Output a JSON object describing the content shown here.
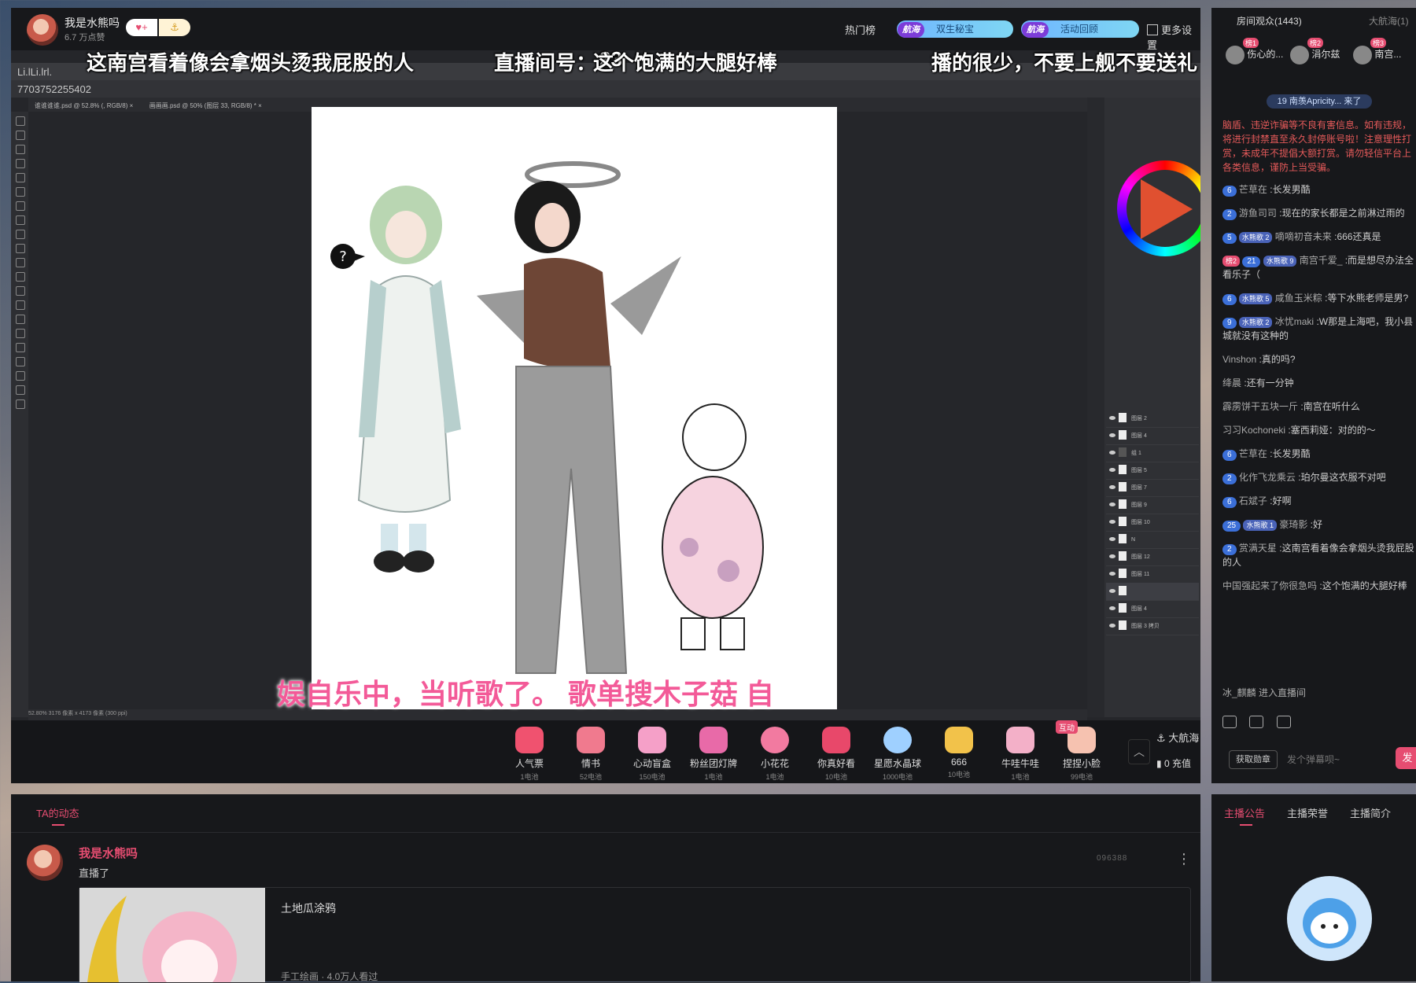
{
  "header": {
    "streamer_name": "我是水熊吗",
    "likes": "6.7 万点赞",
    "hot_rank": "热门榜",
    "pills": [
      {
        "badge": "航海",
        "label": "双生秘宝"
      },
      {
        "badge": "航海",
        "label": "活动回顾"
      }
    ],
    "more_settings": "更多设置"
  },
  "video": {
    "watermark": "Li.lLi.lrl.",
    "room_id": "7703752255402",
    "danmu": [
      "这南宫看着像会拿烟头烫我屁股的人",
      "直播间号：",
      "23",
      "这个饱满的大腿好棒",
      "播的很少，不要上舰不要送礼"
    ],
    "scroll_banner": "娱自乐中，当听歌了。   歌单搜木子菇   自",
    "ps": {
      "tabs": [
        "谁谁谁谁.psd @ 52.8% (, RGB/8) ×",
        "画画画.psd @ 50% (图层 33, RGB/8) * ×"
      ],
      "status": "52.80%    3176 像素 x 4173 像素 (300 ppi)",
      "layers": [
        "图层 2",
        "图层 4",
        "组 1",
        "图层 5",
        "图层 7",
        "图层 9",
        "图层 10",
        "N",
        "图层 12",
        "图层 11",
        "",
        "图层 4",
        "图层 3 拷贝"
      ],
      "bubble": "?"
    }
  },
  "gifts": [
    {
      "name": "人气票",
      "price": "1电池",
      "color": "#f0526f"
    },
    {
      "name": "情书",
      "price": "52电池",
      "color": "#f07a8e"
    },
    {
      "name": "心动盲盒",
      "price": "150电池",
      "color": "#f5a0c8"
    },
    {
      "name": "粉丝团灯牌",
      "price": "1电池",
      "color": "#e86aa8"
    },
    {
      "name": "小花花",
      "price": "1电池",
      "color": "#f27aa0"
    },
    {
      "name": "你真好看",
      "price": "10电池",
      "color": "#e8486a"
    },
    {
      "name": "星愿水晶球",
      "price": "1000电池",
      "color": "#9fd0ff"
    },
    {
      "name": "666",
      "price": "10电池",
      "color": "#f2c24a"
    },
    {
      "name": "牛哇牛哇",
      "price": "1电池",
      "color": "#f3b0c8"
    },
    {
      "name": "捏捏小脸",
      "price": "99电池",
      "color": "#f6c2b0"
    }
  ],
  "gift_tag": "互动",
  "fleet_btn": "大航海",
  "recharge_btn": "0 充值",
  "sidebar": {
    "tab_audience": "房间观众(1443)",
    "tab_fleet": "大航海(1)",
    "ranks": [
      {
        "badge": "榜1",
        "name": "伤心的..."
      },
      {
        "badge": "榜2",
        "name": "涓尔兹"
      },
      {
        "badge": "榜3",
        "name": "南宫..."
      }
    ],
    "enter_banner": "19  南羡Apricity...  来了",
    "notice": "脑盾、违逆诈骗等不良有害信息。如有违规，将进行封禁直至永久封停账号啦！注意理性打赏，未成年不提倡大额打赏。请勿轻信平台上各类信息，谨防上当受骗。",
    "messages": [
      {
        "lv": "6",
        "medal": "",
        "rank": "",
        "user": "芒草在",
        "text": "长发男酷"
      },
      {
        "lv": "2",
        "medal": "",
        "rank": "",
        "user": "游鱼司司",
        "text": "现在的家长都是之前淋过雨的"
      },
      {
        "lv": "5",
        "medal": "水熊歌 2",
        "rank": "",
        "user": "嘀嘀初音未来",
        "text": "666还真是"
      },
      {
        "lv": "21",
        "medal": "水熊歌 9",
        "rank": "榜2",
        "user": "南宫千爱_",
        "text": "而是想尽办法全看乐子（"
      },
      {
        "lv": "6",
        "medal": "水熊歌 5",
        "rank": "",
        "user": "咸鱼玉米粽",
        "text": "等下水熊老师是男?"
      },
      {
        "lv": "9",
        "medal": "水熊歌 2",
        "rank": "",
        "user": "冰忧maki",
        "text": "W那是上海吧，我小县城就没有这种的"
      },
      {
        "lv": "",
        "medal": "",
        "rank": "",
        "user": "Vinshon",
        "text": "真的吗?"
      },
      {
        "lv": "",
        "medal": "",
        "rank": "",
        "user": "绛晨",
        "text": "还有一分钟"
      },
      {
        "lv": "",
        "medal": "",
        "rank": "",
        "user": "霹雳饼干五块一斤",
        "text": "南宫在听什么"
      },
      {
        "lv": "",
        "medal": "",
        "rank": "",
        "user": "习习Kochoneki",
        "text": "塞西莉娅：对的的～"
      },
      {
        "lv": "6",
        "medal": "",
        "rank": "",
        "user": "芒草在",
        "text": "长发男酷"
      },
      {
        "lv": "2",
        "medal": "",
        "rank": "",
        "user": "化作飞龙乘云",
        "text": "珀尔曼这衣服不对吧"
      },
      {
        "lv": "6",
        "medal": "",
        "rank": "",
        "user": "石斌子",
        "text": "好啊"
      },
      {
        "lv": "25",
        "medal": "水熊歌 1",
        "rank": "",
        "user": "豪琦影",
        "text": "好"
      },
      {
        "lv": "2",
        "medal": "",
        "rank": "",
        "user": "赏满天星",
        "text": "这南宫看着像会拿烟头烫我屁股的人"
      },
      {
        "lv": "",
        "medal": "",
        "rank": "",
        "user": "中国强起来了你很急吗",
        "text": "这个饱满的大腿好棒"
      }
    ],
    "enter_notice": "冰_麒麟  进入直播间",
    "get_medal": "获取勋章",
    "input_placeholder": "发个弹幕呗~",
    "send": "发"
  },
  "dynamics": {
    "tab": "TA的动态",
    "name": "我是水熊吗",
    "action": "直播了",
    "title": "土地瓜涂鸦",
    "meta": "手工绘画 · 4.0万人看过",
    "number": "096388"
  },
  "announce": {
    "tabs": [
      "主播公告",
      "主播荣誉",
      "主播简介"
    ]
  }
}
